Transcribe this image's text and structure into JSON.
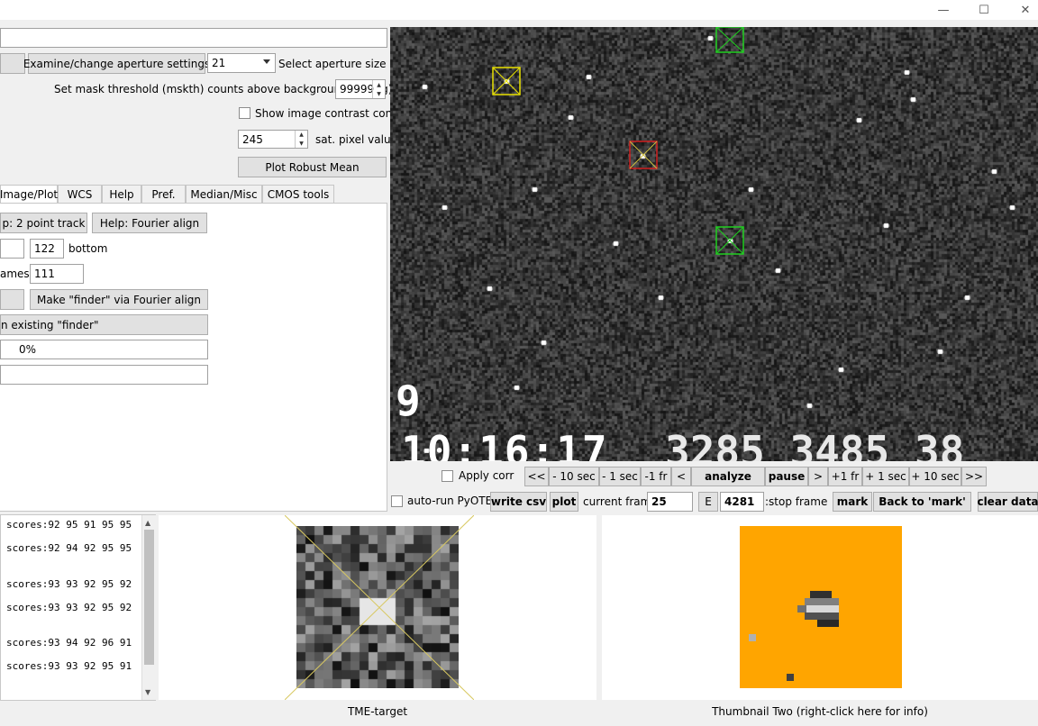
{
  "window": {
    "minimize_glyph": "—",
    "maximize_glyph": "☐",
    "close_glyph": "✕"
  },
  "top": {
    "examine_button": "Examine/change aperture settings",
    "aperture_size_value": "21",
    "aperture_size_label": "Select aperture size",
    "mask_threshold_label": "Set mask threshold (mskth) counts above background (bkavg)",
    "mask_threshold_value": "99999",
    "contrast_label": "Show image contrast control",
    "sat_value": "245",
    "sat_label": "sat. pixel value",
    "robust_mean_button": "Plot Robust Mean"
  },
  "tabs": [
    "Image/Plot",
    "WCS",
    "Help",
    "Pref.",
    "Median/Misc",
    "CMOS tools"
  ],
  "tab_content": {
    "help_2pt_button": "p: 2 point track",
    "help_fourier_button": "Help: Fourier align",
    "bottom_value": "122",
    "bottom_label": "bottom",
    "frames_label": "ames:",
    "frames_value": "111",
    "make_finder_button": "Make \"finder\" via Fourier align",
    "existing_finder_button": "n existing  \"finder\"",
    "progress_text": "0%"
  },
  "image": {
    "overlay_big_digit": "9",
    "overlay_timestamp": "10:16:17",
    "overlay_rest": "3285 3485 38",
    "colors": {
      "yellow": "#e8e000",
      "red": "#d02020",
      "green": "#20d020"
    }
  },
  "playback": {
    "apply_corr": "Apply corr",
    "buttons": [
      "<<",
      "- 10 sec",
      "- 1 sec",
      "-1 fr",
      "<",
      "analyze",
      "pause",
      ">",
      "+1 fr",
      "+ 1 sec",
      "+ 10 sec",
      ">>"
    ]
  },
  "control_row": {
    "auto_run": "auto-run PyOTE",
    "write_csv": "write csv",
    "plot": "plot",
    "current_frame_label": "current frame:",
    "current_frame_value": "25",
    "e_button": "E",
    "stop_frame_value": "4281",
    "stop_frame_label": ":stop frame",
    "mark": "mark",
    "back_to_mark": "Back to 'mark'",
    "clear_data": "clear data"
  },
  "scores": [
    "scores:92 95 91 95 95",
    "scores:92 94 92 95 95",
    "scores:93 93 92 95 92",
    "scores:93 93 92 95 92",
    "scores:93 94 92 96 91",
    "scores:93 93 92 95 91"
  ],
  "thumbnails": {
    "one_caption": "TME-target",
    "two_caption": "Thumbnail Two (right-click here for info)",
    "two_bg": "#ffa500"
  }
}
